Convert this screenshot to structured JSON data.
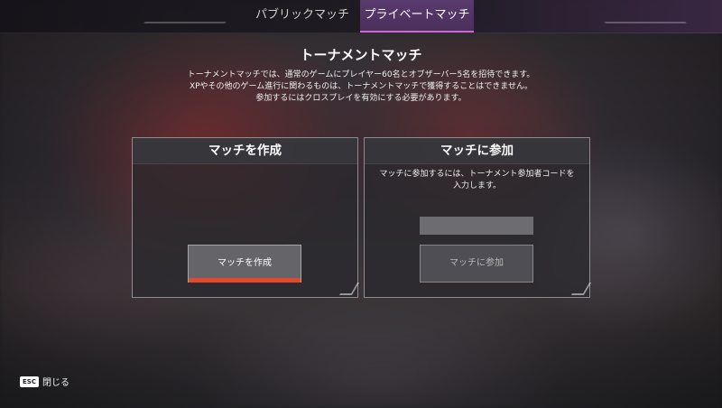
{
  "tabs": [
    {
      "label": "パブリックマッチ",
      "active": false
    },
    {
      "label": "プライベートマッチ",
      "active": true
    }
  ],
  "header": {
    "title": "トーナメントマッチ",
    "lines": [
      "トーナメントマッチでは、通常のゲームにプレイヤー60名とオブザーバー5名を招待できます。",
      "XPやその他のゲーム進行に関わるものは、トーナメントマッチで獲得することはできません。",
      "参加するにはクロスプレイを有効にする必要があります。"
    ]
  },
  "create_panel": {
    "title": "マッチを作成",
    "button_label": "マッチを作成"
  },
  "join_panel": {
    "title": "マッチに参加",
    "text_lines": [
      "マッチに参加するには、トーナメント参加者コードを",
      "入力します。"
    ],
    "code_value": "",
    "button_label": "マッチに参加"
  },
  "footer": {
    "key": "ESC",
    "label": "閉じる"
  },
  "colors": {
    "active_tab": "#4a2f5c",
    "accent": "#e2482a"
  }
}
